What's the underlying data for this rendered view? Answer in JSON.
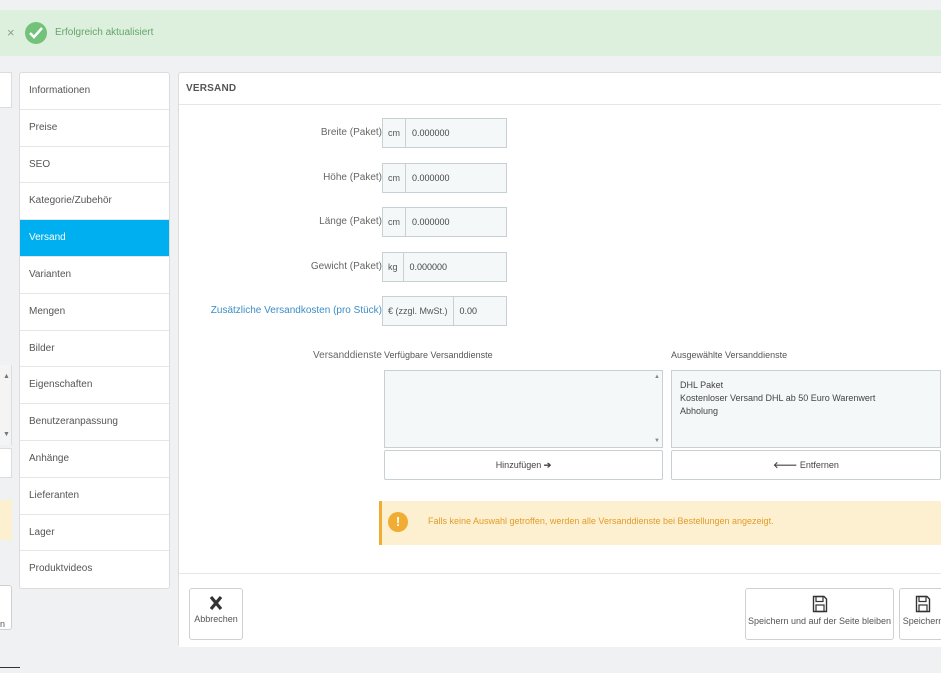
{
  "alert": {
    "close": "×",
    "message": "Erfolgreich aktualisiert"
  },
  "left_cut": {
    "button_text": "n"
  },
  "tabs": [
    {
      "label": "Informationen"
    },
    {
      "label": "Preise"
    },
    {
      "label": "SEO"
    },
    {
      "label": "Kategorie/Zubehör"
    },
    {
      "label": "Versand",
      "active": true
    },
    {
      "label": "Varianten"
    },
    {
      "label": "Mengen"
    },
    {
      "label": "Bilder"
    },
    {
      "label": "Eigenschaften"
    },
    {
      "label": "Benutzeranpassung"
    },
    {
      "label": "Anhänge"
    },
    {
      "label": "Lieferanten"
    },
    {
      "label": "Lager"
    },
    {
      "label": "Produktvideos"
    }
  ],
  "panel": {
    "heading": "VERSAND",
    "fields": {
      "width": {
        "label": "Breite (Paket)",
        "unit": "cm",
        "value": "0.000000"
      },
      "height": {
        "label": "Höhe (Paket)",
        "unit": "cm",
        "value": "0.000000"
      },
      "depth": {
        "label": "Länge (Paket)",
        "unit": "cm",
        "value": "0.000000"
      },
      "weight": {
        "label": "Gewicht (Paket)",
        "unit": "kg",
        "value": "0.000000"
      },
      "extra_cost": {
        "label": "Zusätzliche Versandkosten (pro Stück)",
        "unit": "€ (zzgl. MwSt.)",
        "value": "0.00"
      }
    },
    "carriers": {
      "label": "Versanddienste",
      "available_title": "Verfügbare Versanddienste",
      "selected_title": "Ausgewählte Versanddienste",
      "available": [],
      "selected": [
        "DHL Paket",
        "Kostenloser Versand DHL ab 50 Euro Warenwert",
        "Abholung"
      ],
      "add_label": "Hinzufügen",
      "remove_label": "Entfernen"
    },
    "warning": "Falls keine Auswahl getroffen, werden alle Versanddienste bei Bestellungen angezeigt.",
    "footer": {
      "cancel": "Abbrechen",
      "save_stay": "Speichern und auf der Seite bleiben",
      "save": "Speichern"
    }
  },
  "colors": {
    "accent": "#00aff0",
    "success_bg": "#ddf0de",
    "warning": "#f0ac33"
  }
}
